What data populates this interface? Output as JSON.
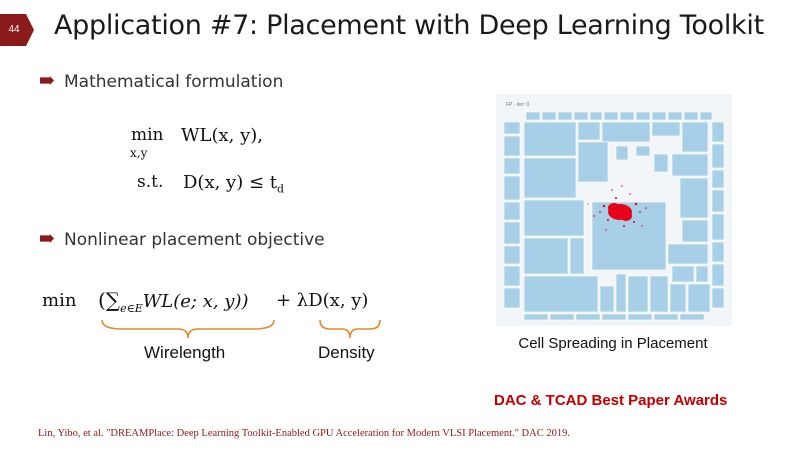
{
  "slide": {
    "number": "44",
    "title": "Application #7: Placement with Deep Learning Toolkit",
    "accent_color": "#8b1a1a"
  },
  "bullets": [
    {
      "text": "Mathematical formulation"
    },
    {
      "text": "Nonlinear placement objective"
    }
  ],
  "formulation": {
    "min_op": "min",
    "min_sub": "x,y",
    "objective": "WL(x, y),",
    "st": "s.t.",
    "constraint": "D(x, y) ≤ t",
    "constraint_sub": "d"
  },
  "objective_eq": {
    "min_op": "min",
    "wl_term": "(∑",
    "wl_sub": "e∈E",
    "wl_body": "WL(e; x, y))",
    "plus": "+ λD(x, y)"
  },
  "labels": {
    "wirelength": "Wirelength",
    "density": "Density"
  },
  "figure": {
    "tag": "FP - iter: 0",
    "caption": "Cell Spreading in Placement",
    "block_color": "#a8cfe8",
    "cell_color": "#e8001a"
  },
  "award": "DAC & TCAD Best Paper Awards",
  "citation": "Lin, Yibo, et al. \"DREAMPlace: Deep Learning Toolkit-Enabled GPU Acceleration for Modern VLSI Placement.\" DAC 2019."
}
